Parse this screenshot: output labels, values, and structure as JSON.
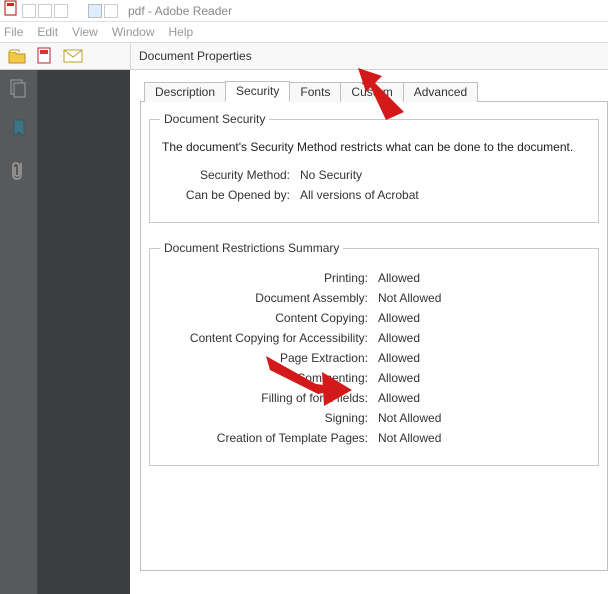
{
  "window": {
    "title": "pdf - Adobe Reader"
  },
  "menubar": [
    "File",
    "Edit",
    "View",
    "Window",
    "Help"
  ],
  "panel": {
    "title": "Document Properties"
  },
  "tabs": {
    "items": [
      "Description",
      "Security",
      "Fonts",
      "Custom",
      "Advanced"
    ],
    "active_index": 1
  },
  "security": {
    "legend": "Document Security",
    "intro": "The document's Security Method restricts what can be done to the document.",
    "rows": [
      {
        "label": "Security Method:",
        "value": "No Security"
      },
      {
        "label": "Can be Opened by:",
        "value": "All versions of Acrobat"
      }
    ]
  },
  "restrictions": {
    "legend": "Document Restrictions Summary",
    "rows": [
      {
        "label": "Printing:",
        "value": "Allowed"
      },
      {
        "label": "Document Assembly:",
        "value": "Not Allowed"
      },
      {
        "label": "Content Copying:",
        "value": "Allowed"
      },
      {
        "label": "Content Copying for Accessibility:",
        "value": "Allowed"
      },
      {
        "label": "Page Extraction:",
        "value": "Allowed"
      },
      {
        "label": "Commenting:",
        "value": "Allowed"
      },
      {
        "label": "Filling of form fields:",
        "value": "Allowed"
      },
      {
        "label": "Signing:",
        "value": "Not Allowed"
      },
      {
        "label": "Creation of Template Pages:",
        "value": "Not Allowed"
      }
    ]
  }
}
